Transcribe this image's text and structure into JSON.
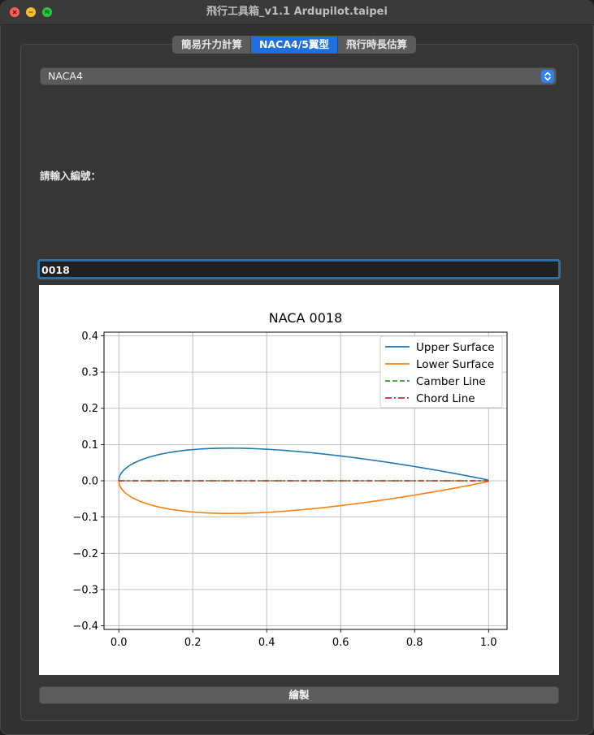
{
  "window": {
    "title": "飛行工具箱_v1.1 Ardupilot.taipei"
  },
  "tabs": [
    {
      "label": "簡易升力計算",
      "active": false
    },
    {
      "label": "NACA4/5翼型",
      "active": true
    },
    {
      "label": "飛行時長估算",
      "active": false
    }
  ],
  "series_select": {
    "value": "NACA4"
  },
  "prompt_label": "請輸入編號：",
  "code_input": {
    "value": "0018"
  },
  "draw_button": {
    "label": "繪製"
  },
  "colors": {
    "upper": "#1f77b4",
    "lower": "#ff7f0e",
    "camber": "#2ca02c",
    "chord": "#d62728",
    "accent": "#1f6fe0"
  },
  "chart_data": {
    "type": "line",
    "title": "NACA 0018",
    "xlabel": "",
    "ylabel": "",
    "xlim": [
      -0.04,
      1.05
    ],
    "ylim": [
      -0.41,
      0.41
    ],
    "xticks": [
      0.0,
      0.2,
      0.4,
      0.6,
      0.8,
      1.0
    ],
    "xtick_labels": [
      "0.0",
      "0.2",
      "0.4",
      "0.6",
      "0.8",
      "1.0"
    ],
    "yticks": [
      0.4,
      0.3,
      0.2,
      0.1,
      0.0,
      -0.1,
      -0.2,
      -0.3,
      -0.4
    ],
    "ytick_labels": [
      "0.4",
      "0.3",
      "0.2",
      "0.1",
      "0.0",
      "−0.1",
      "−0.2",
      "−0.3",
      "−0.4"
    ],
    "grid": true,
    "legend_position": "upper-right",
    "naca": {
      "m": 0,
      "p": 0,
      "t": 0.18
    },
    "series": [
      {
        "name": "Upper Surface",
        "style": "solid",
        "color": "#1f77b4"
      },
      {
        "name": "Lower Surface",
        "style": "solid",
        "color": "#ff7f0e"
      },
      {
        "name": "Camber Line",
        "style": "dashed",
        "color": "#2ca02c"
      },
      {
        "name": "Chord Line",
        "style": "dashdot",
        "color": "#d62728"
      }
    ]
  }
}
